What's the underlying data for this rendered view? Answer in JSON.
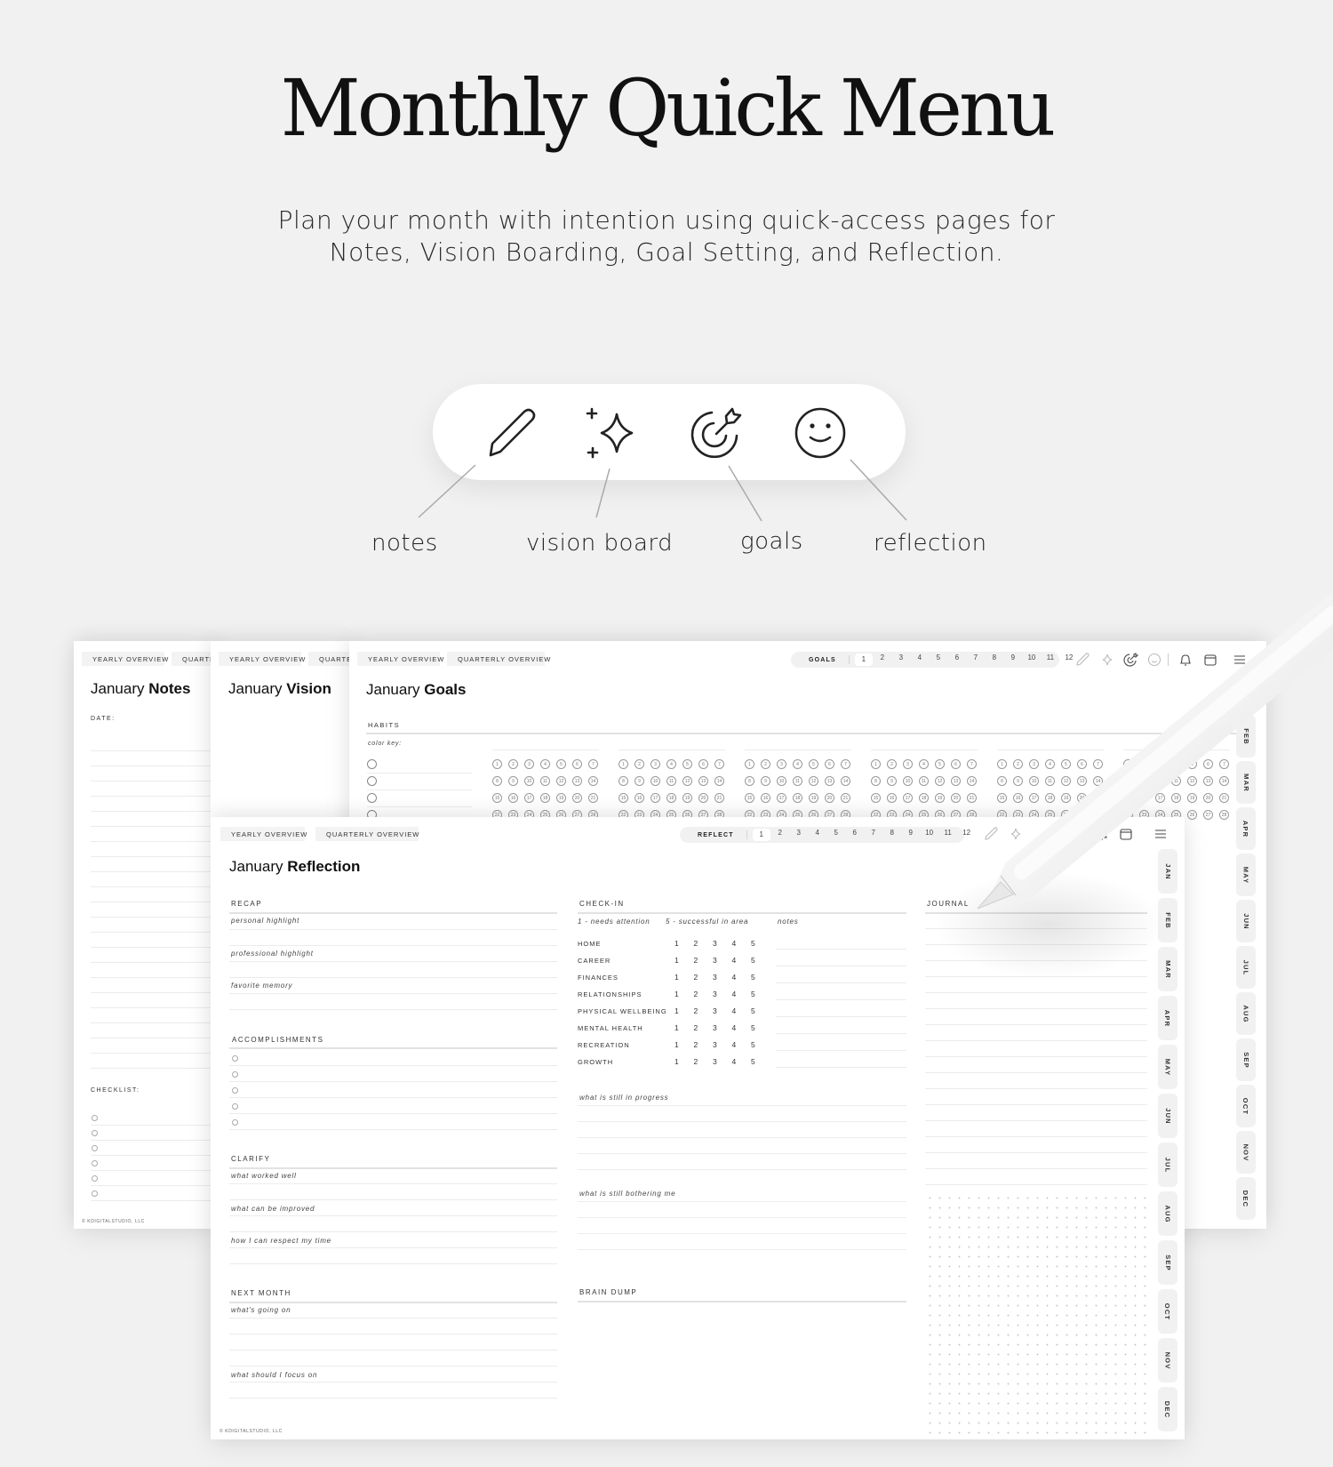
{
  "hero": {
    "title": "Monthly Quick Menu",
    "subtitle_line1": "Plan your month with intention using quick-access pages for",
    "subtitle_line2": "Notes, Vision Boarding, Goal Setting, and Reflection."
  },
  "quick_menu": {
    "items": [
      {
        "icon": "pencil-icon",
        "label": "notes"
      },
      {
        "icon": "sparkle-icon",
        "label": "vision board"
      },
      {
        "icon": "target-arrow-icon",
        "label": "goals"
      },
      {
        "icon": "smiley-icon",
        "label": "reflection"
      }
    ]
  },
  "nav": {
    "yearly": "YEARLY OVERVIEW",
    "quarterly": "QUARTERLY OVERVIEW",
    "quarterly_cut": "QUARTER"
  },
  "notes_page": {
    "title_month": "January",
    "title_word": "Notes",
    "date_label": "DATE:",
    "checklist_label": "CHECKLIST:",
    "footer": "© KDIGITALSTUDIO, LLC"
  },
  "vision_page": {
    "title_month": "January",
    "title_word": "Vision"
  },
  "goals_page": {
    "title_month": "January",
    "title_word": "Goals",
    "pager_label": "GOALS",
    "habits_label": "HABITS",
    "color_key": "color key:",
    "months_visible": [
      "FEB",
      "MAR",
      "APR",
      "MAY",
      "JUN",
      "JUL",
      "AUG",
      "SEP",
      "OCT",
      "NOV",
      "DEC"
    ]
  },
  "reflection_page": {
    "title_month": "January",
    "title_word": "Reflection",
    "pager_label": "REFLECT",
    "pages": [
      "1",
      "2",
      "3",
      "4",
      "5",
      "6",
      "7",
      "8",
      "9",
      "10",
      "11",
      "12"
    ],
    "active_page": "1",
    "recap": {
      "label": "RECAP",
      "prompts": [
        "personal highlight",
        "professional highlight",
        "favorite memory"
      ]
    },
    "accomplishments": {
      "label": "ACCOMPLISHMENTS"
    },
    "clarify": {
      "label": "CLARIFY",
      "prompts": [
        "what worked well",
        "what can be improved",
        "how I can respect my time"
      ]
    },
    "next_month": {
      "label": "NEXT MONTH",
      "prompts": [
        "what's going on",
        "what should I focus on"
      ]
    },
    "checkin": {
      "label": "CHECK-IN",
      "scale_low": "1 - needs attention",
      "scale_high": "5 - successful in area",
      "notes_label": "notes",
      "areas": [
        "HOME",
        "CAREER",
        "FINANCES",
        "RELATIONSHIPS",
        "PHYSICAL WELLBEING",
        "MENTAL HEALTH",
        "RECREATION",
        "GROWTH"
      ],
      "scale": [
        "1",
        "2",
        "3",
        "4",
        "5"
      ],
      "prompt_progress": "what is still in progress",
      "prompt_bothering": "what is still bothering me"
    },
    "brain_dump": "BRAIN DUMP",
    "journal": "JOURNAL",
    "months": [
      "JAN",
      "FEB",
      "MAR",
      "APR",
      "MAY",
      "JUN",
      "JUL",
      "AUG",
      "SEP",
      "OCT",
      "NOV",
      "DEC"
    ],
    "footer": "© KDIGITALSTUDIO, LLC"
  }
}
